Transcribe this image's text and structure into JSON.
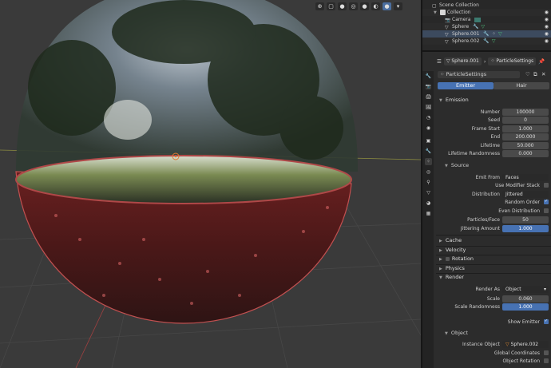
{
  "colors": {
    "accent": "#4772b3",
    "panel_bg": "#2c2c2c",
    "viewport_bg": "#3a3a3a",
    "selected_row": "#3c4a5e"
  },
  "outliner": {
    "title": "Scene Collection",
    "rows": [
      {
        "label": "Collection",
        "icon": "collection-icon"
      },
      {
        "label": "Camera",
        "icon": "camera-icon"
      },
      {
        "label": "Sphere",
        "icon": "mesh-icon"
      },
      {
        "label": "Sphere.001",
        "icon": "mesh-icon"
      },
      {
        "label": "Sphere.002",
        "icon": "mesh-icon"
      }
    ]
  },
  "properties": {
    "object_name": "Sphere.001",
    "settings_name": "ParticleSettings",
    "particle_system": "ParticleSettings",
    "tab_emitter": "Emitter",
    "tab_hair": "Hair",
    "emission": {
      "title": "Emission",
      "number_label": "Number",
      "number": "100000",
      "seed_label": "Seed",
      "seed": "0",
      "frame_start_label": "Frame Start",
      "frame_start": "1.000",
      "end_label": "End",
      "end": "200.000",
      "lifetime_label": "Lifetime",
      "lifetime": "50.000",
      "lifetime_rand_label": "Lifetime Randomness",
      "lifetime_rand": "0.000"
    },
    "source": {
      "title": "Source",
      "emit_from_label": "Emit From",
      "emit_from": "Faces",
      "use_modifier_stack": "Use Modifier Stack",
      "distribution_label": "Distribution",
      "distribution": "Jittered",
      "random_order": "Random Order",
      "even_distribution": "Even Distribution",
      "particles_face_label": "Particles/Face",
      "particles_face": "50",
      "jittering_label": "Jittering Amount",
      "jittering": "1.000"
    },
    "collapsed": {
      "cache": "Cache",
      "velocity": "Velocity",
      "rotation": "Rotation",
      "physics": "Physics"
    },
    "render": {
      "title": "Render",
      "render_as_label": "Render As",
      "render_as": "Object",
      "scale_label": "Scale",
      "scale": "0.060",
      "scale_rand_label": "Scale Randomness",
      "scale_rand": "1.000",
      "show_emitter": "Show Emitter"
    },
    "object": {
      "title": "Object",
      "instance_object_label": "Instance Object",
      "instance_object": "Sphere.002",
      "global_coords": "Global Coordinates",
      "object_rotation": "Object Rotation"
    }
  }
}
